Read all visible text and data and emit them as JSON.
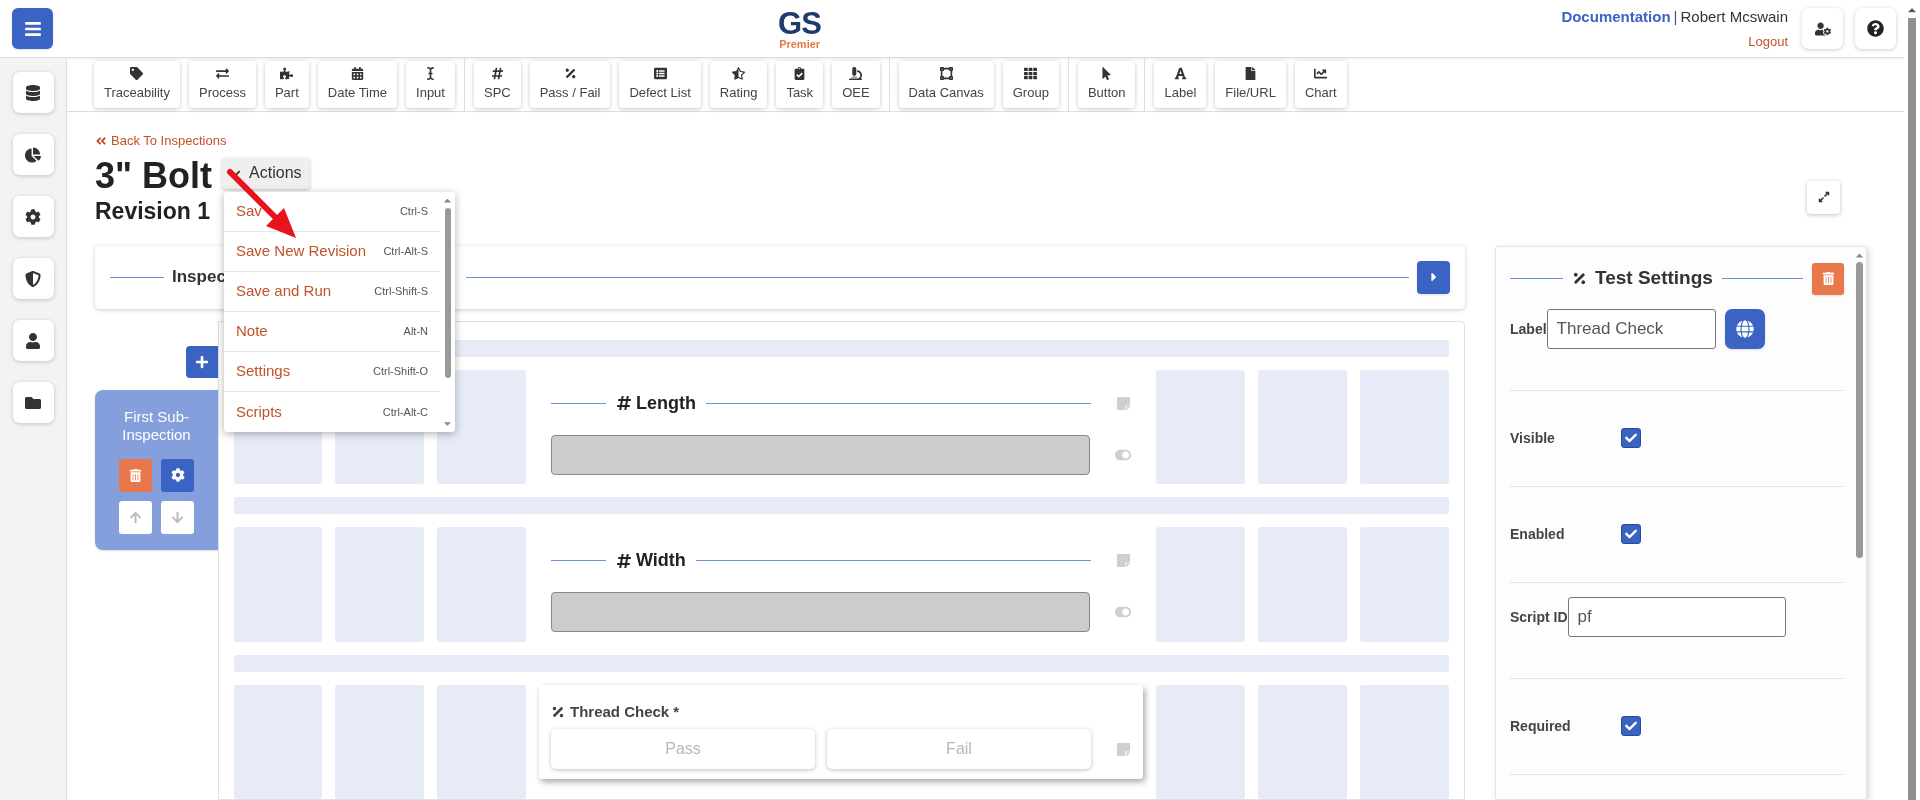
{
  "header": {
    "logo": "GS",
    "logo_sub": "Premier",
    "doc_link": "Documentation",
    "separator": "|",
    "user": "Robert Mcswain",
    "logout": "Logout"
  },
  "toolbar": {
    "groups": [
      {
        "items": [
          "Traceability",
          "Process",
          "Part",
          "Date Time",
          "Input"
        ]
      },
      {
        "items": [
          "SPC",
          "Pass / Fail",
          "Defect List",
          "Rating",
          "Task",
          "OEE"
        ]
      },
      {
        "items": [
          "Data Canvas",
          "Group"
        ]
      },
      {
        "items": [
          "Button"
        ]
      },
      {
        "items": [
          "Label",
          "File/URL",
          "Chart"
        ]
      }
    ]
  },
  "back_link": "Back To Inspections",
  "title": "3\" Bolt",
  "revision": "Revision 1",
  "actions": {
    "label": "Actions",
    "expanded": true,
    "menu": [
      {
        "label": "Sav",
        "shortcut": "Ctrl-S"
      },
      {
        "label": "Save New Revision",
        "shortcut": "Ctrl-Alt-S"
      },
      {
        "label": "Save and Run",
        "shortcut": "Ctrl-Shift-S"
      },
      {
        "label": "Note",
        "shortcut": "Alt-N"
      },
      {
        "label": "Settings",
        "shortcut": "Ctrl-Shift-O"
      },
      {
        "label": "Scripts",
        "shortcut": "Ctrl-Alt-C"
      }
    ]
  },
  "inspection_bar": {
    "title": "Inspec"
  },
  "sub_inspections": [
    {
      "title": "First Sub-Inspection",
      "selected": true
    }
  ],
  "tests": [
    {
      "kind": "numeric",
      "title": "Length"
    },
    {
      "kind": "numeric",
      "title": "Width"
    },
    {
      "kind": "pass_fail",
      "title": "Thread Check *",
      "buttons": [
        "Pass",
        "Fail"
      ],
      "selected": true
    }
  ],
  "settings": {
    "title": "Test Settings",
    "fields": [
      {
        "kind": "text",
        "label": "Label",
        "value": "Thread Check",
        "translate": true
      },
      {
        "kind": "checkbox",
        "label": "Visible",
        "checked": true
      },
      {
        "kind": "checkbox",
        "label": "Enabled",
        "checked": true
      },
      {
        "kind": "text",
        "label": "Script ID",
        "value": "pf",
        "translate": false
      },
      {
        "kind": "checkbox",
        "label": "Required",
        "checked": true
      }
    ]
  }
}
